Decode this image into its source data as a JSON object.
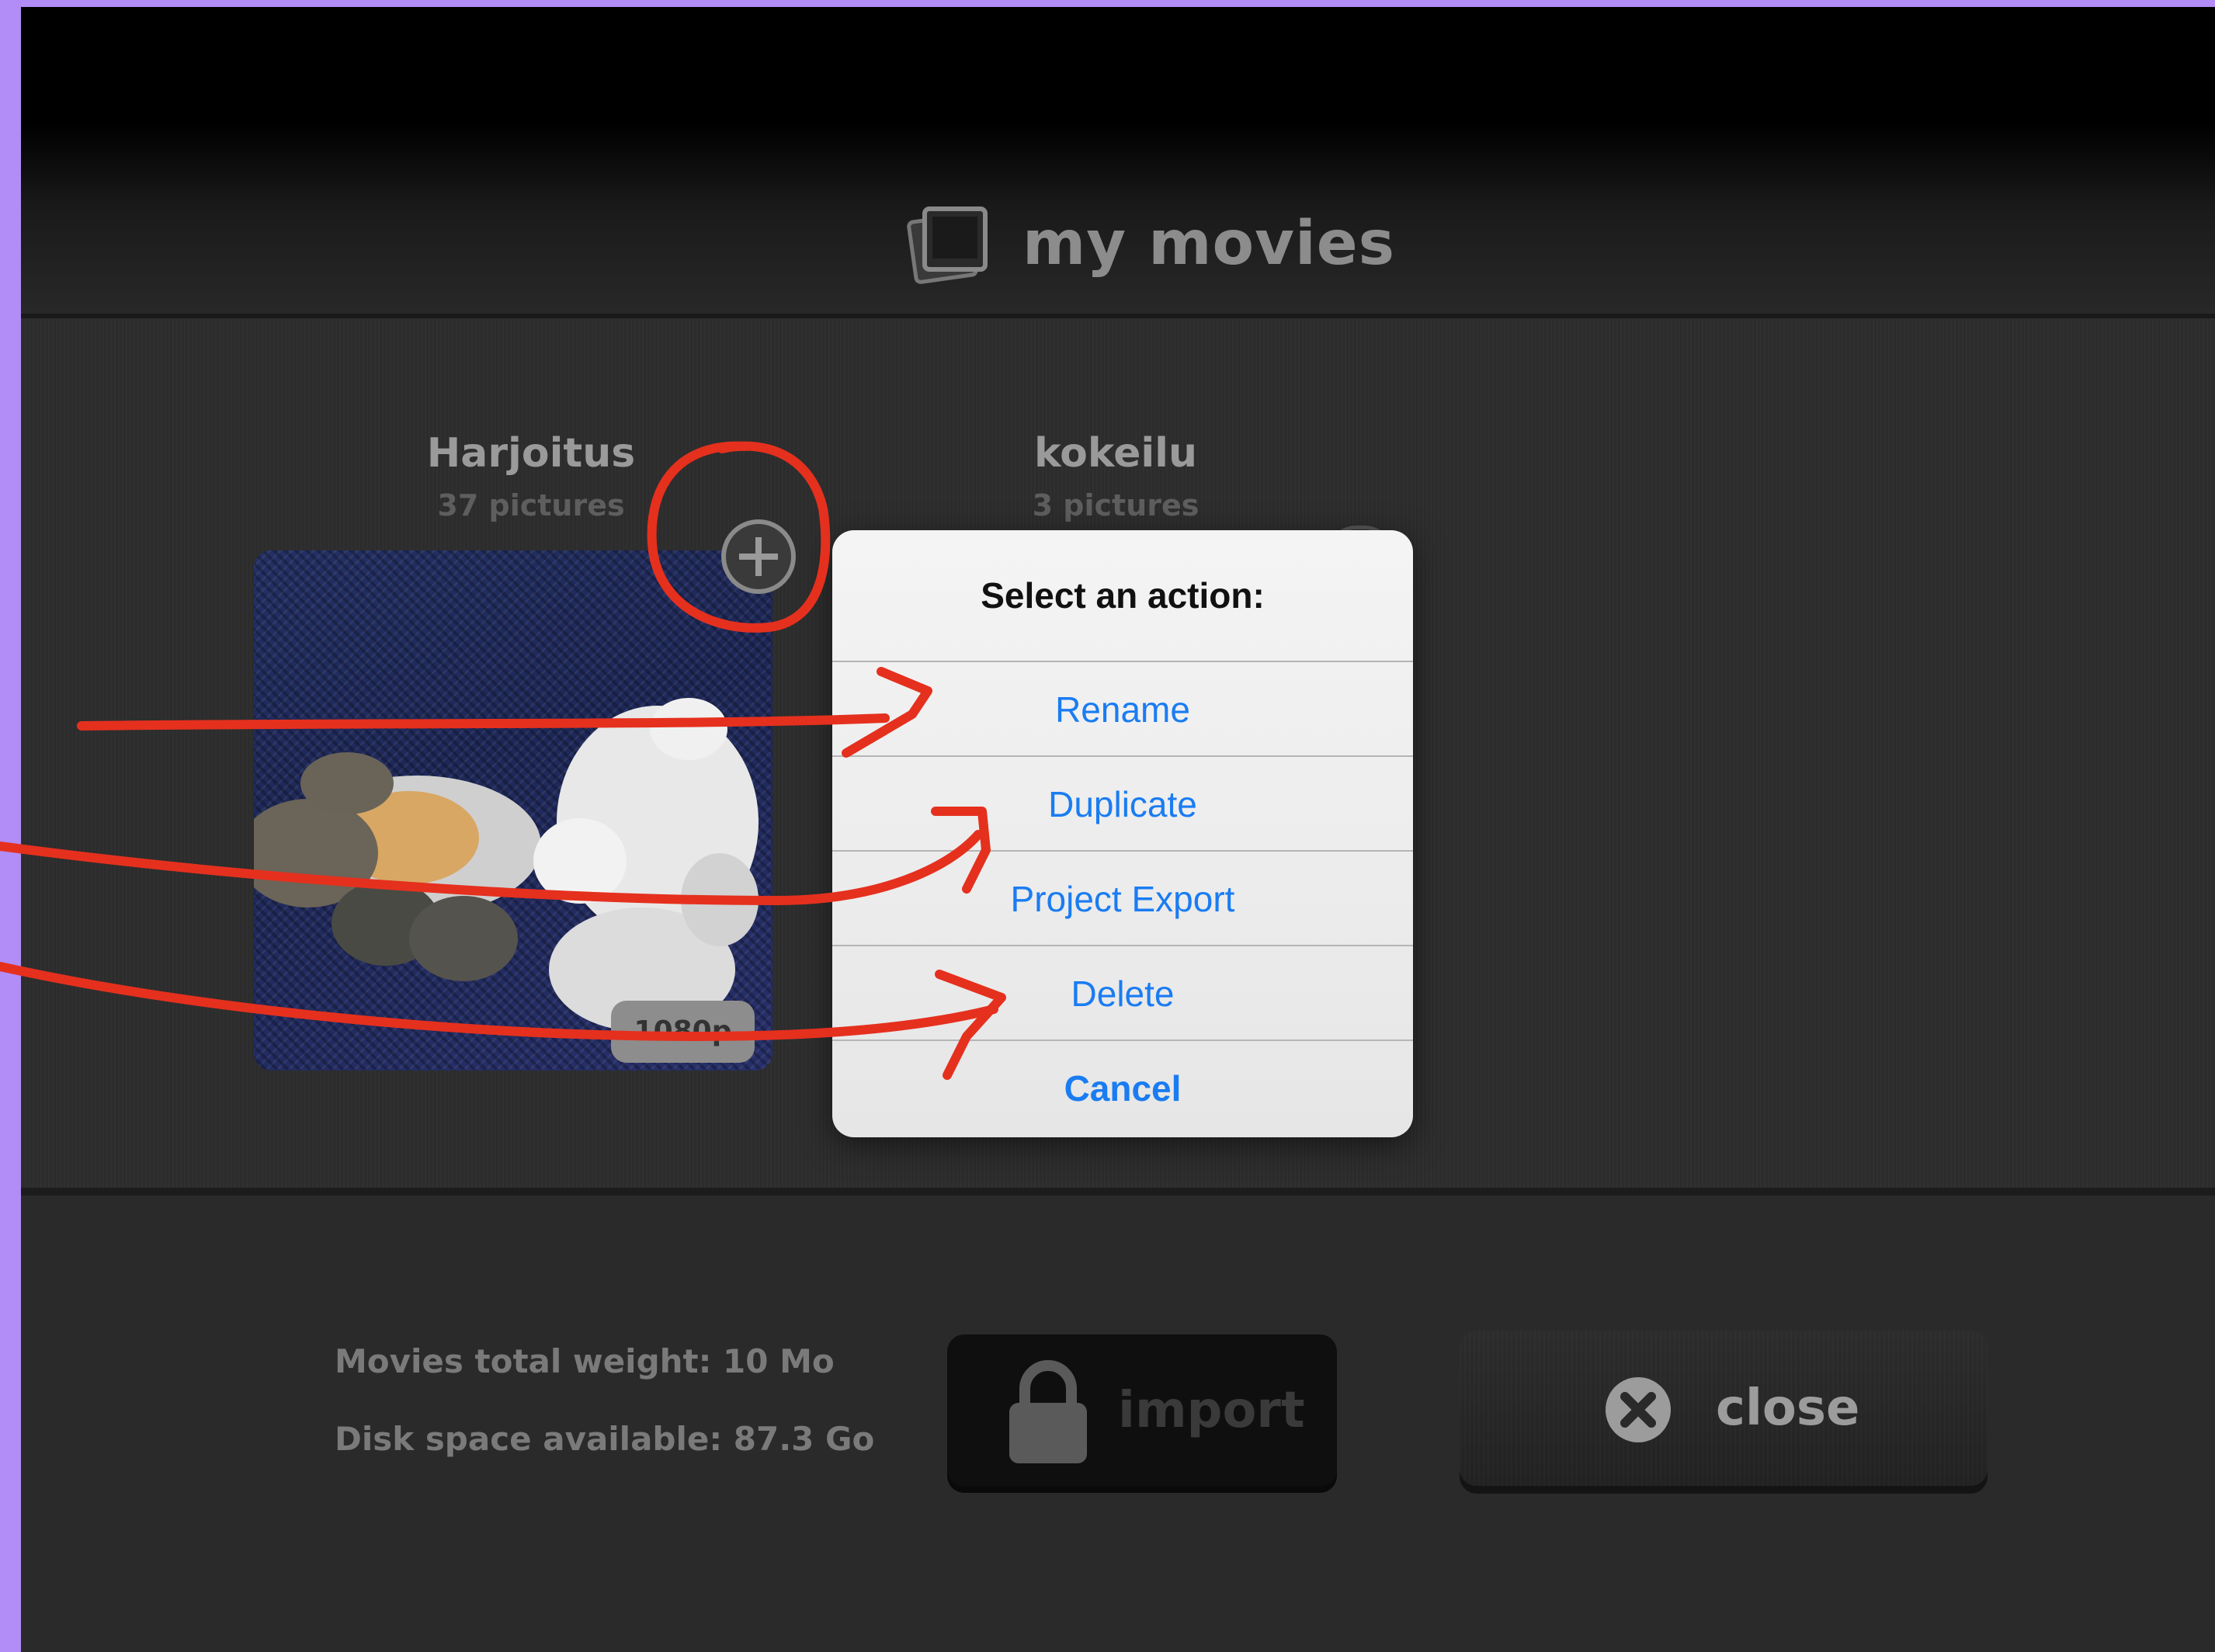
{
  "header": {
    "title": "my movies"
  },
  "projects": [
    {
      "title": "Harjoitus",
      "count": "37 pictures",
      "resolution": "1080p"
    },
    {
      "title": "kokeilu",
      "count": "3 pictures"
    }
  ],
  "action_sheet": {
    "title": "Select an action:",
    "items": [
      "Rename",
      "Duplicate",
      "Project Export",
      "Delete"
    ],
    "cancel": "Cancel",
    "accent": "#1a7cf2"
  },
  "footer": {
    "total_weight": "Movies total weight: 10 Mo",
    "disk_space": "Disk space available: 87.3 Go",
    "import_label": "import",
    "close_label": "close"
  },
  "colors": {
    "frame": "#b28cf7",
    "background": "#2a2a2a",
    "annotation": "#e5301e"
  }
}
